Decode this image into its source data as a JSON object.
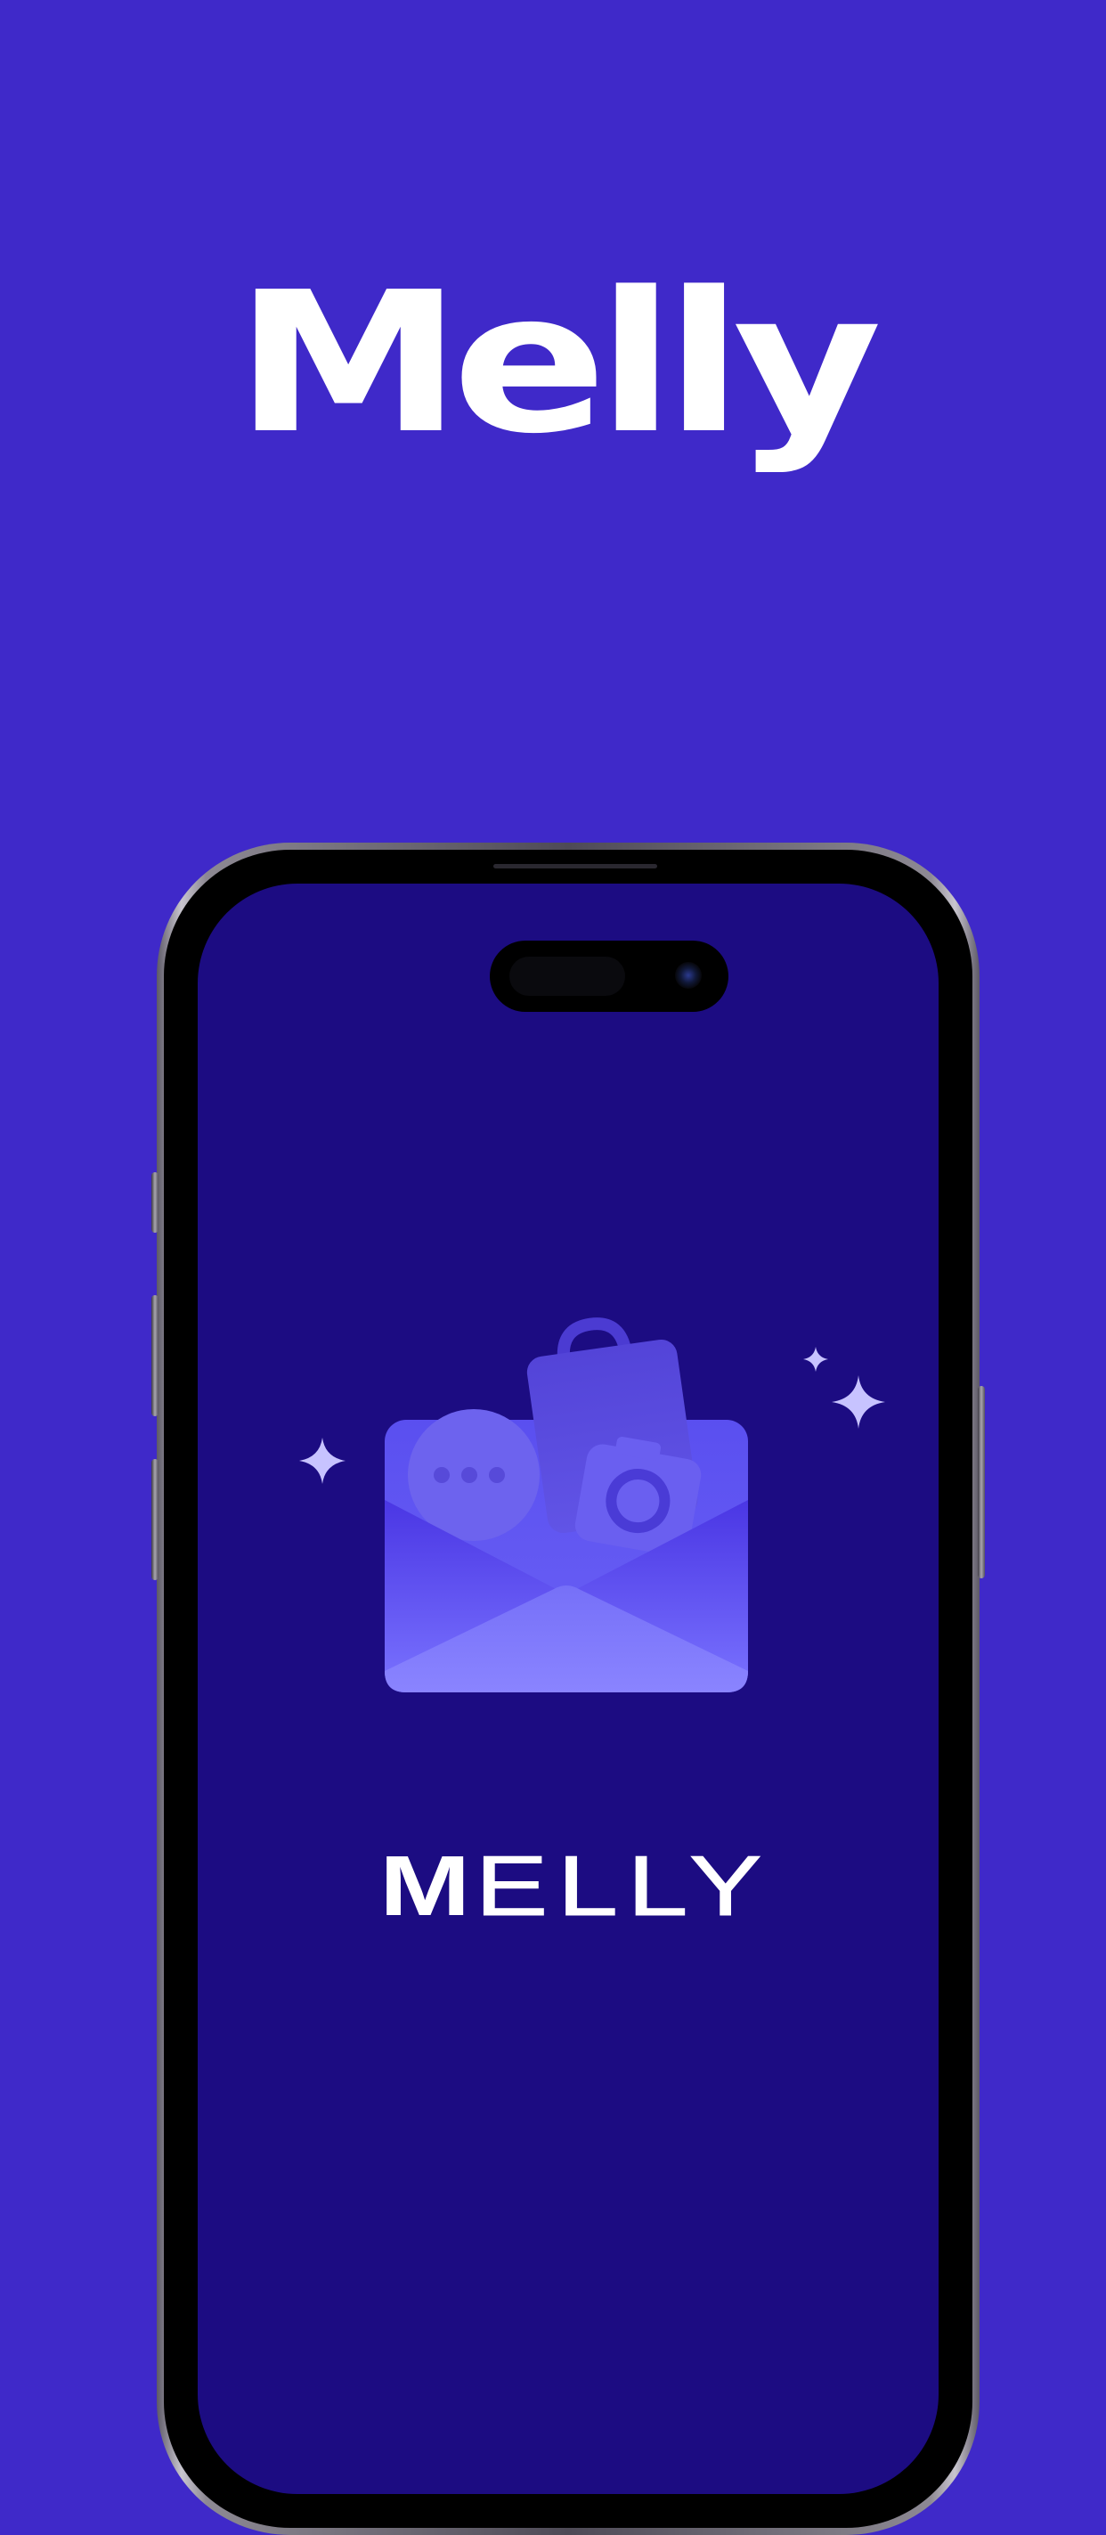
{
  "hero": {
    "title": "Melly"
  },
  "app_screen": {
    "wordmark_first": "M",
    "wordmark_rest": "ELLY",
    "illustration_icons": [
      "sparkle-icon",
      "envelope-icon",
      "chat-bubble-icon",
      "shopping-bag-icon",
      "camera-icon"
    ]
  },
  "colors": {
    "background": "#3f29c9",
    "screen_background": "#1c0c82",
    "envelope_light": "#8a84ff",
    "envelope_mid": "#6a5ff0",
    "text": "#ffffff"
  }
}
